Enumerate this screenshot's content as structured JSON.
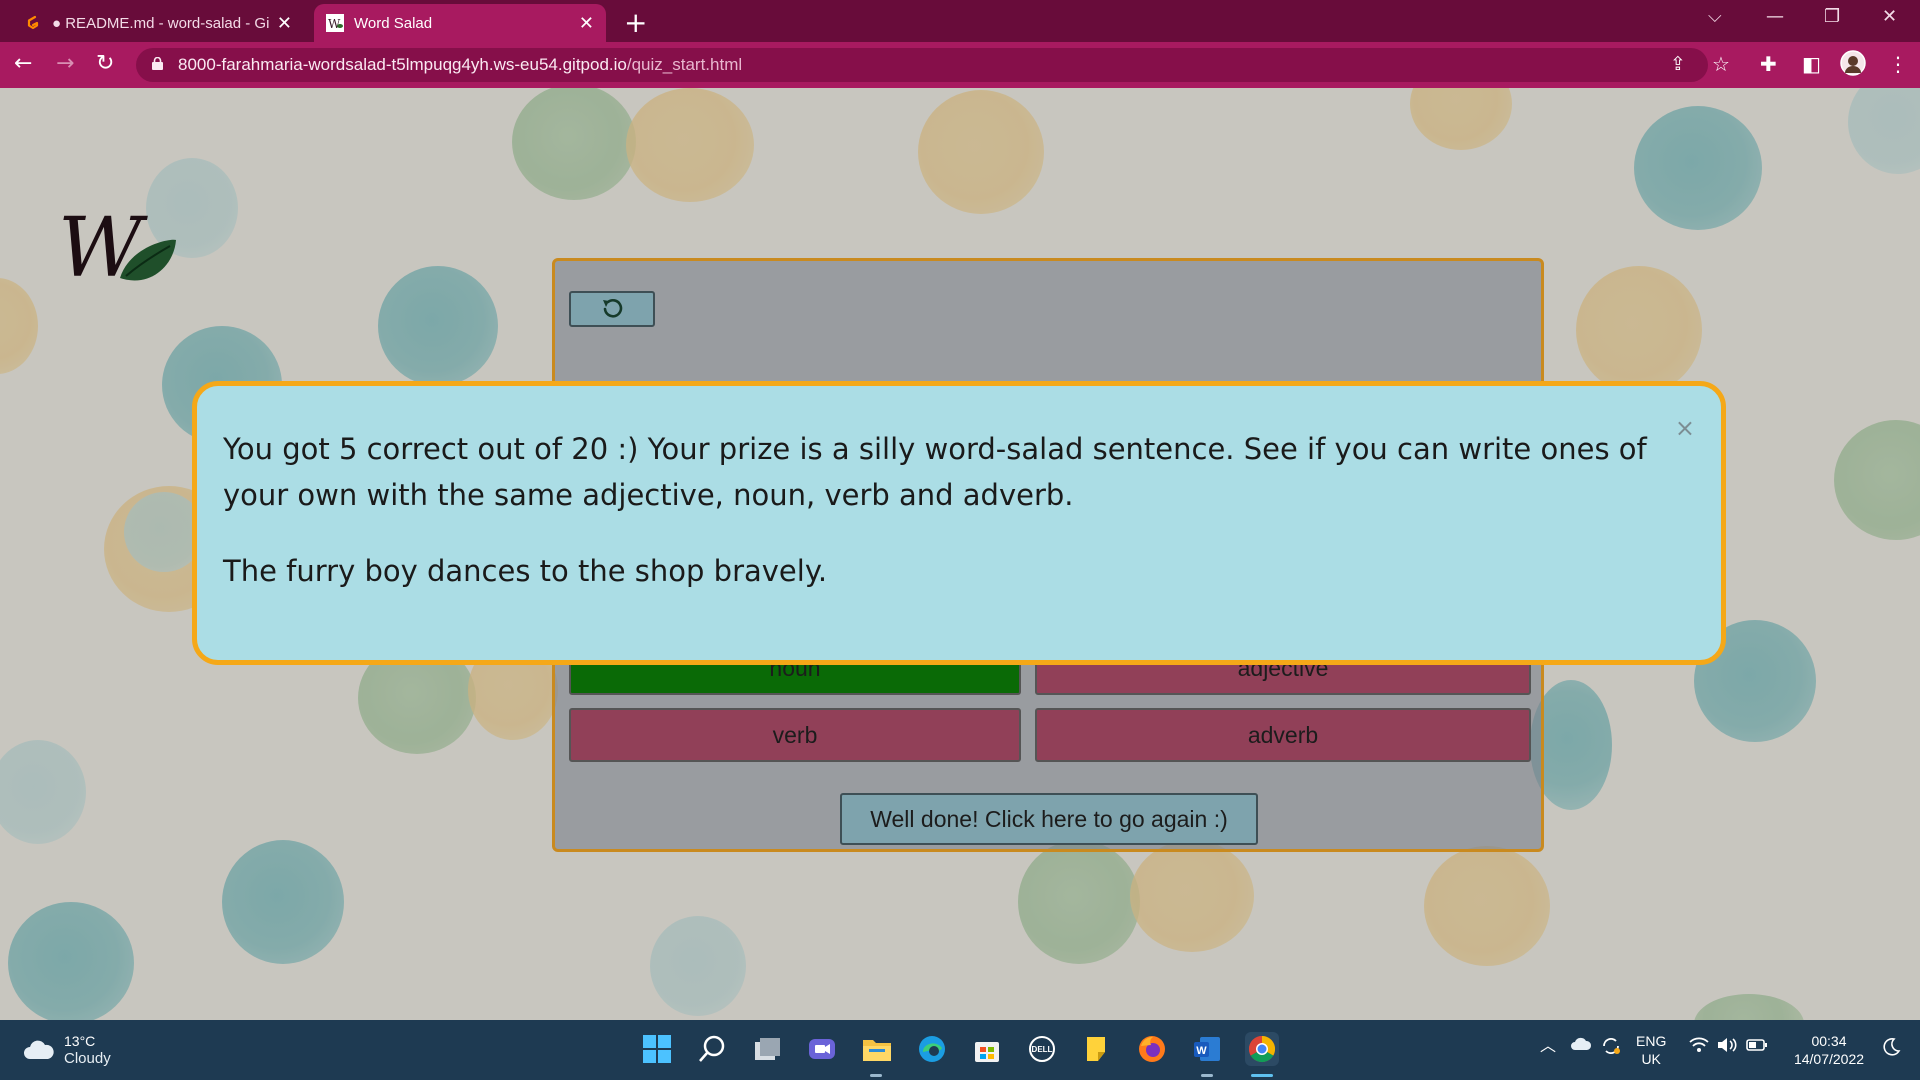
{
  "browser": {
    "tabs": [
      {
        "title": "● README.md - word-salad - Git",
        "active": false
      },
      {
        "title": "Word Salad",
        "active": true
      }
    ],
    "new_tab_label": "+",
    "url_host": "8000-farahmaria-wordsalad-t5lmpuqg4yh.ws-eu54.gitpod.io",
    "url_path": "/quiz_start.html",
    "theme_color": "#a81a60"
  },
  "logo": {
    "letters": "W"
  },
  "quiz": {
    "reset_icon": "reset-icon",
    "answers": [
      {
        "label": "noun",
        "state": "correct"
      },
      {
        "label": "adjective",
        "state": "wrong"
      },
      {
        "label": "verb",
        "state": "wrong"
      },
      {
        "label": "adverb",
        "state": "wrong"
      }
    ],
    "again_label": "Well done! Click here to go again :)"
  },
  "modal": {
    "message": "You got 5 correct out of 20 :) Your prize is a silly word-salad sentence. See if you can write ones of your own with the same adjective, noun, verb and adverb.",
    "sentence": "The furry boy dances to the shop bravely.",
    "close_label": "×",
    "border_color": "#f5a818",
    "background_color": "#abdde5"
  },
  "taskbar": {
    "weather_temp": "13°C",
    "weather_condition": "Cloudy",
    "language_line1": "ENG",
    "language_line2": "UK",
    "time": "00:34",
    "date": "14/07/2022"
  }
}
